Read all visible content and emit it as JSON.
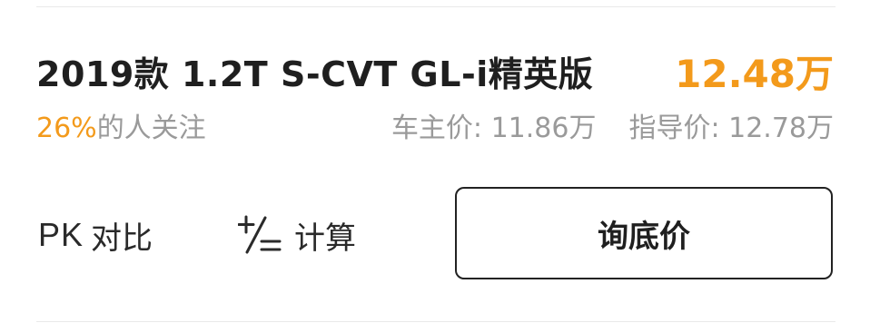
{
  "trim": {
    "title": "2019款 1.2T S-CVT GL-i精英版",
    "price": "12.48万",
    "attention_percent": "26%",
    "attention_suffix": "的人关注",
    "owner_price": "车主价: 11.86万",
    "guide_price": "指导价: 12.78万"
  },
  "actions": {
    "pk_prefix": "PK",
    "pk_label": "对比",
    "calc_label": "计算",
    "inquire_label": "询底价"
  },
  "colors": {
    "accent": "#f39a1b",
    "text_primary": "#1f1f1f",
    "text_secondary": "#9a9a9a",
    "divider": "#e9e9e9"
  },
  "icons": {
    "calculator": "plus-minus-equals-icon"
  }
}
